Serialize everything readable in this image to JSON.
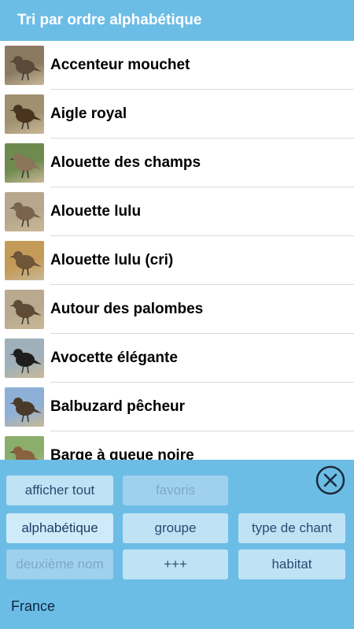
{
  "header": {
    "title": "Tri par ordre alphabétique"
  },
  "birds": [
    {
      "name": "Accenteur mouchet",
      "thumb_bg": "#8a7a62",
      "thumb_fg": "#5a4a3a"
    },
    {
      "name": "Aigle royal",
      "thumb_bg": "#a09070",
      "thumb_fg": "#4a3420"
    },
    {
      "name": "Alouette des champs",
      "thumb_bg": "#6f8a4f",
      "thumb_fg": "#8c7458"
    },
    {
      "name": "Alouette lulu",
      "thumb_bg": "#b9a78d",
      "thumb_fg": "#7a6450"
    },
    {
      "name": "Alouette lulu (cri)",
      "thumb_bg": "#c49a58",
      "thumb_fg": "#6e5636"
    },
    {
      "name": "Autour des palombes",
      "thumb_bg": "#b9a98f",
      "thumb_fg": "#5e4a36"
    },
    {
      "name": "Avocette élégante",
      "thumb_bg": "#9fb0ba",
      "thumb_fg": "#1e1e1e"
    },
    {
      "name": "Balbuzard pêcheur",
      "thumb_bg": "#8fb0d6",
      "thumb_fg": "#4a3a2a"
    },
    {
      "name": "Barge à queue noire",
      "thumb_bg": "#8cae6c",
      "thumb_fg": "#8a6240"
    }
  ],
  "filters": {
    "show_all": "afficher tout",
    "favorites": "favoris",
    "alphabetical": "alphabétique",
    "group": "groupe",
    "song_type": "type de chant",
    "second_name": "deuxième nom",
    "more": "+++",
    "habitat": "habitat"
  },
  "country": "France",
  "colors": {
    "accent": "#6cbde6",
    "button": "#bfe3f5",
    "button_text": "#2a4a72"
  },
  "icons": {
    "close": "close-icon"
  }
}
